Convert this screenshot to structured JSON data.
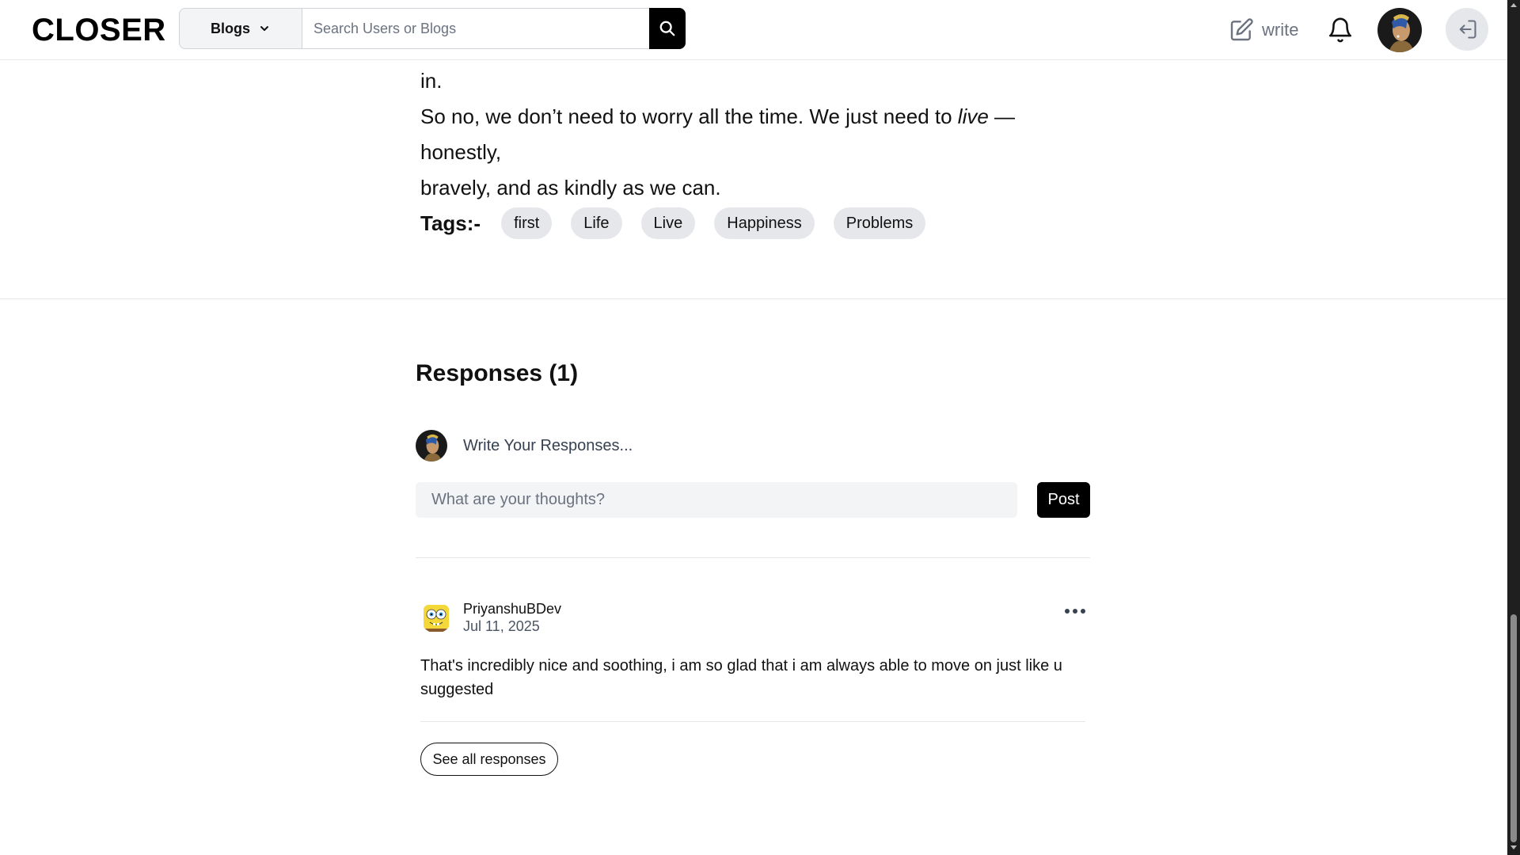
{
  "header": {
    "logo": "CLOSER",
    "category_label": "Blogs",
    "search_placeholder": "Search Users or Blogs",
    "write_label": "write"
  },
  "article": {
    "lines": [
      "in.",
      "So no, we don’t need to worry all the time. We just need to",
      "live",
      "— honestly,",
      "bravely, and as kindly as we can."
    ]
  },
  "tags": {
    "label": "Tags:-",
    "items": [
      "first",
      "Life",
      "Live",
      "Happiness",
      "Problems"
    ]
  },
  "responses": {
    "title": "Responses (1)",
    "write_prompt": "Write Your Responses...",
    "input_placeholder": "What are your thoughts?",
    "post_label": "Post",
    "comments": [
      {
        "user": "PriyanshuBDev",
        "date": "Jul 11, 2025",
        "text": "That's incredibly nice and soothing, i am so glad that i am always able to move on just like u suggested"
      }
    ],
    "see_all_label": "See all responses"
  },
  "colors": {
    "accent": "#000000",
    "tag_bg": "#e5e7eb",
    "input_bg": "#f3f4f6"
  }
}
